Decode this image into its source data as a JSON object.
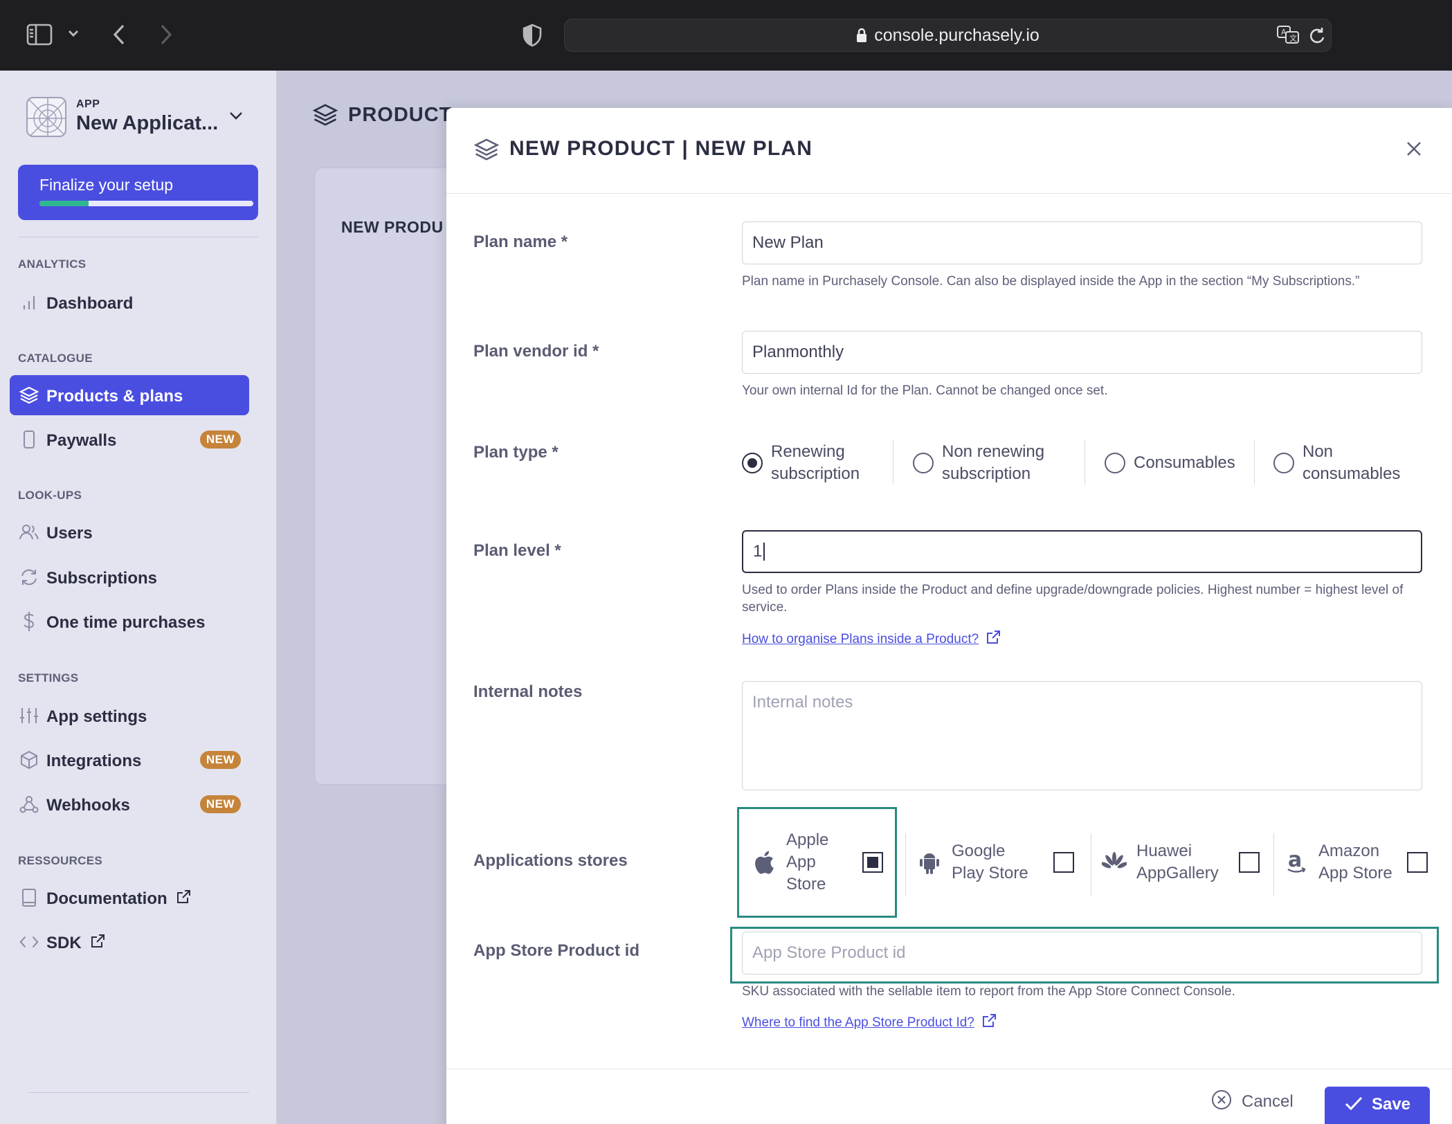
{
  "browser": {
    "url": "console.purchasely.io",
    "icons": [
      "sidebar-toggle-icon",
      "chevron-down-icon",
      "back-icon",
      "forward-icon",
      "shield-icon",
      "lock-icon",
      "translate-icon",
      "reload-icon"
    ]
  },
  "sidebar": {
    "app_kicker": "APP",
    "app_name": "New Applicat...",
    "finalize": {
      "label": "Finalize your setup",
      "progress": 0.23
    },
    "sections": {
      "analytics": "ANALYTICS",
      "catalogue": "CATALOGUE",
      "lookups": "LOOK-UPS",
      "settings": "SETTINGS",
      "resources": "RESSOURCES"
    },
    "items": {
      "dashboard": "Dashboard",
      "products": "Products & plans",
      "paywalls": "Paywalls",
      "users": "Users",
      "subscriptions": "Subscriptions",
      "one_time": "One time purchases",
      "app_settings": "App settings",
      "integrations": "Integrations",
      "webhooks": "Webhooks",
      "documentation": "Documentation",
      "sdk": "SDK"
    },
    "badge_new": "NEW"
  },
  "background": {
    "header": "PRODUCT",
    "card_title": "NEW PRODU"
  },
  "modal": {
    "title": "NEW PRODUCT | NEW PLAN",
    "fields": {
      "plan_name": {
        "label": "Plan name *",
        "value": "New Plan",
        "help": "Plan name in Purchasely Console. Can also be displayed inside the App in the section “My Subscriptions.”"
      },
      "plan_vendor_id": {
        "label": "Plan vendor id *",
        "value": "Planmonthly",
        "help": "Your own internal Id for the Plan. Cannot be changed once set."
      },
      "plan_type": {
        "label": "Plan type *",
        "options": [
          {
            "line1": "Renewing",
            "line2": "subscription",
            "selected": true
          },
          {
            "line1": "Non renewing",
            "line2": "subscription",
            "selected": false
          },
          {
            "line1": "Consumables",
            "line2": "",
            "selected": false
          },
          {
            "line1": "Non",
            "line2": "consumables",
            "selected": false
          }
        ]
      },
      "plan_level": {
        "label": "Plan level *",
        "value": "1",
        "help": "Used to order Plans inside the Product and define upgrade/downgrade policies. Highest number = highest level of service.",
        "link": "How to organise Plans inside a Product?"
      },
      "internal_notes": {
        "label": "Internal notes",
        "placeholder": "Internal notes"
      },
      "stores": {
        "label": "Applications stores",
        "items": [
          {
            "l1": "Apple",
            "l2": "App",
            "l3": "Store",
            "checked": true,
            "icon": "apple-icon"
          },
          {
            "l1": "Google",
            "l2": "Play Store",
            "l3": "",
            "checked": false,
            "icon": "android-icon"
          },
          {
            "l1": "Huawei",
            "l2": "AppGallery",
            "l3": "",
            "checked": false,
            "icon": "huawei-icon"
          },
          {
            "l1": "Amazon",
            "l2": "App Store",
            "l3": "",
            "checked": false,
            "icon": "amazon-icon"
          }
        ]
      },
      "app_store_product_id": {
        "label": "App Store Product id",
        "placeholder": "App Store Product id",
        "help": "SKU associated with the sellable item to report from the App Store Connect Console.",
        "link": "Where to find the App Store Product Id?"
      }
    },
    "footer": {
      "cancel": "Cancel",
      "save": "Save"
    }
  },
  "colors": {
    "accent": "#4a4ee0",
    "badge": "#c5843a",
    "highlight": "#2a8a82",
    "progress": "#2fb88f"
  }
}
